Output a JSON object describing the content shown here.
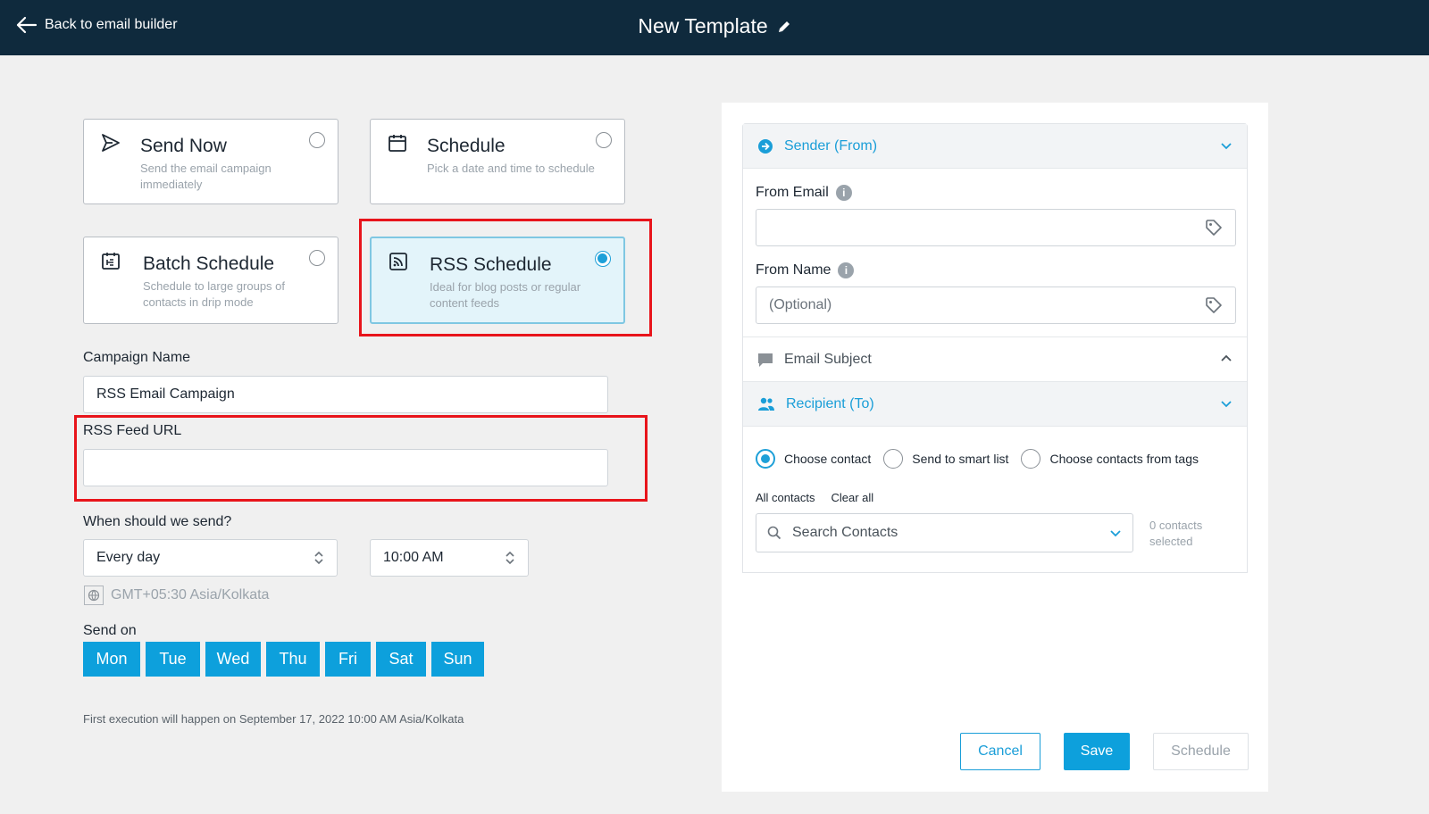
{
  "header": {
    "back_label": "Back to email builder",
    "title": "New Template"
  },
  "send_options": [
    {
      "title": "Send Now",
      "desc": "Send the email campaign immediately",
      "selected": false
    },
    {
      "title": "Schedule",
      "desc": "Pick a date and time to schedule",
      "selected": false
    },
    {
      "title": "Batch Schedule",
      "desc": "Schedule to large groups of contacts in drip mode",
      "selected": false
    },
    {
      "title": "RSS Schedule",
      "desc": "Ideal for blog posts or regular content feeds",
      "selected": true
    }
  ],
  "campaign": {
    "name_label": "Campaign Name",
    "name_value": "RSS Email Campaign",
    "rss_label": "RSS Feed URL",
    "rss_value": "",
    "when_label": "When should we send?",
    "frequency": "Every day",
    "time": "10:00 AM",
    "timezone": "GMT+05:30 Asia/Kolkata",
    "send_on_label": "Send on",
    "days": [
      "Mon",
      "Tue",
      "Wed",
      "Thu",
      "Fri",
      "Sat",
      "Sun"
    ],
    "execution_note": "First execution will happen on September 17, 2022 10:00 AM Asia/Kolkata"
  },
  "sender": {
    "header": "Sender (From)",
    "from_email_label": "From Email",
    "from_email_value": "",
    "from_name_label": "From Name",
    "from_name_placeholder": "(Optional)"
  },
  "subject": {
    "header": "Email Subject"
  },
  "recipient": {
    "header": "Recipient (To)",
    "options": [
      {
        "label": "Choose contact",
        "selected": true
      },
      {
        "label": "Send to smart list",
        "selected": false
      },
      {
        "label": "Choose contacts from tags",
        "selected": false
      }
    ],
    "all_contacts": "All contacts",
    "clear_all": "Clear all",
    "search_placeholder": "Search Contacts",
    "contacts_selected": "0 contacts selected"
  },
  "actions": {
    "cancel": "Cancel",
    "save": "Save",
    "schedule": "Schedule"
  },
  "colors": {
    "header_bg": "#0f2a3d",
    "accent": "#0da0dc",
    "highlight": "#e8141b"
  }
}
